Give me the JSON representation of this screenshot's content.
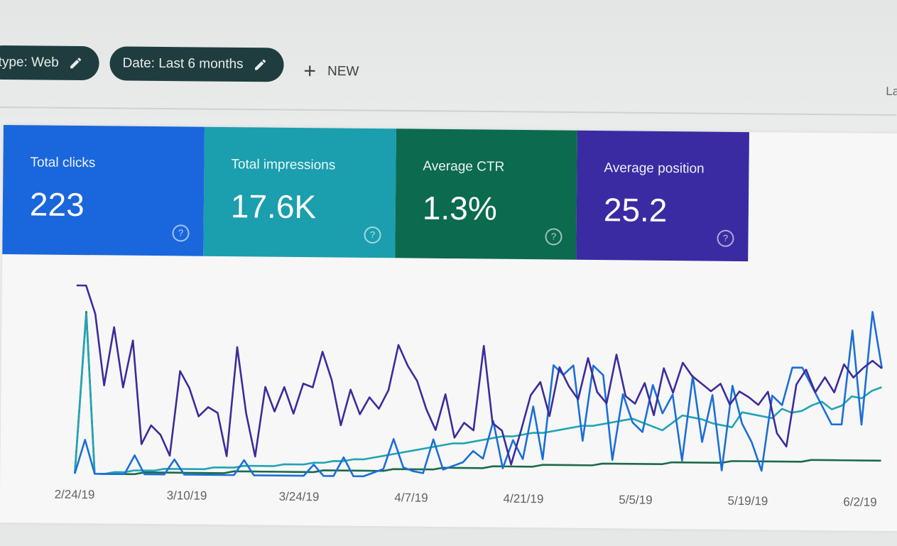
{
  "filters": {
    "type_chip": "type: Web",
    "date_chip": "Date: Last 6 months",
    "new_button": "NEW",
    "corner_text": "La"
  },
  "metrics": [
    {
      "label": "Total clicks",
      "value": "223",
      "color": "#1a66dc"
    },
    {
      "label": "Total impressions",
      "value": "17.6K",
      "color": "#1b9eae"
    },
    {
      "label": "Average CTR",
      "value": "1.3%",
      "color": "#0c6a4e"
    },
    {
      "label": "Average position",
      "value": "25.2",
      "color": "#3a2ba2"
    }
  ],
  "chart_data": {
    "type": "line",
    "x_tick_labels": [
      "2/24/19",
      "3/10/19",
      "3/24/19",
      "4/7/19",
      "4/21/19",
      "5/5/19",
      "5/19/19",
      "6/2/19"
    ],
    "grid": false,
    "series": [
      {
        "color": "#3b2c9c",
        "values": [
          100,
          100,
          85,
          47,
          78,
          46,
          71,
          16,
          26,
          21,
          10,
          55,
          46,
          31,
          36,
          33,
          10,
          68,
          33,
          10,
          47,
          34,
          47,
          33,
          49,
          47,
          66,
          51,
          27,
          46,
          33,
          42,
          36,
          46,
          70,
          59,
          51,
          36,
          25,
          44,
          21,
          29,
          25,
          70,
          29,
          25,
          7,
          25,
          44,
          51,
          33,
          59,
          49,
          42,
          64,
          46,
          40,
          66,
          44,
          40,
          51,
          34,
          59,
          46,
          62,
          55,
          51,
          47,
          51,
          40,
          47,
          44,
          40,
          47,
          25,
          18,
          51,
          59,
          47,
          55,
          47,
          62,
          55,
          60,
          64,
          60
        ]
      },
      {
        "color": "#1a6fd8",
        "values": [
          0,
          18,
          0,
          0,
          0,
          0,
          10,
          0,
          0,
          0,
          8,
          0,
          0,
          0,
          0,
          0,
          0,
          8,
          0,
          0,
          0,
          0,
          0,
          0,
          6,
          0,
          0,
          10,
          0,
          0,
          2,
          4,
          20,
          5,
          3,
          2,
          20,
          4,
          6,
          8,
          14,
          10,
          30,
          5,
          20,
          10,
          38,
          10,
          60,
          55,
          60,
          20,
          60,
          55,
          10,
          45,
          30,
          25,
          50,
          35,
          45,
          10,
          55,
          20,
          45,
          5,
          50,
          30,
          20,
          5,
          45,
          40,
          60,
          60,
          50,
          40,
          30,
          30,
          80,
          30,
          90,
          60
        ]
      },
      {
        "color": "#22a4b4",
        "values": [
          0,
          85,
          0,
          0,
          1,
          1,
          2,
          2,
          2,
          3,
          3,
          3,
          3,
          3,
          4,
          4,
          4,
          5,
          5,
          5,
          5,
          6,
          6,
          6,
          7,
          7,
          8,
          8,
          9,
          9,
          10,
          11,
          12,
          13,
          14,
          15,
          16,
          17,
          18,
          18,
          19,
          20,
          21,
          22,
          22,
          23,
          24,
          24,
          25,
          26,
          27,
          28,
          28,
          29,
          30,
          31,
          32,
          30,
          28,
          26,
          30,
          34,
          33,
          32,
          30,
          29,
          28,
          36,
          35,
          34,
          33,
          38,
          36,
          37,
          40,
          42,
          38,
          40,
          45,
          44,
          48,
          50
        ]
      },
      {
        "color": "#1c6a4a",
        "values": [
          0,
          86,
          0,
          0,
          0,
          0,
          0,
          1,
          1,
          1,
          1,
          1,
          1,
          1,
          1,
          1,
          2,
          2,
          2,
          2,
          2,
          2,
          2,
          2,
          2,
          3,
          3,
          3,
          3,
          3,
          3,
          3,
          4,
          4,
          4,
          4,
          4,
          5,
          5,
          5,
          5,
          5,
          6,
          6,
          6,
          6,
          6,
          7,
          7,
          7,
          7,
          7,
          7,
          8,
          8,
          8,
          8,
          8,
          8,
          8,
          9,
          9,
          9,
          9,
          9,
          9,
          10,
          10,
          10,
          10,
          10,
          10,
          10,
          10,
          11,
          11,
          11,
          11,
          11,
          11,
          11,
          11
        ]
      }
    ]
  }
}
